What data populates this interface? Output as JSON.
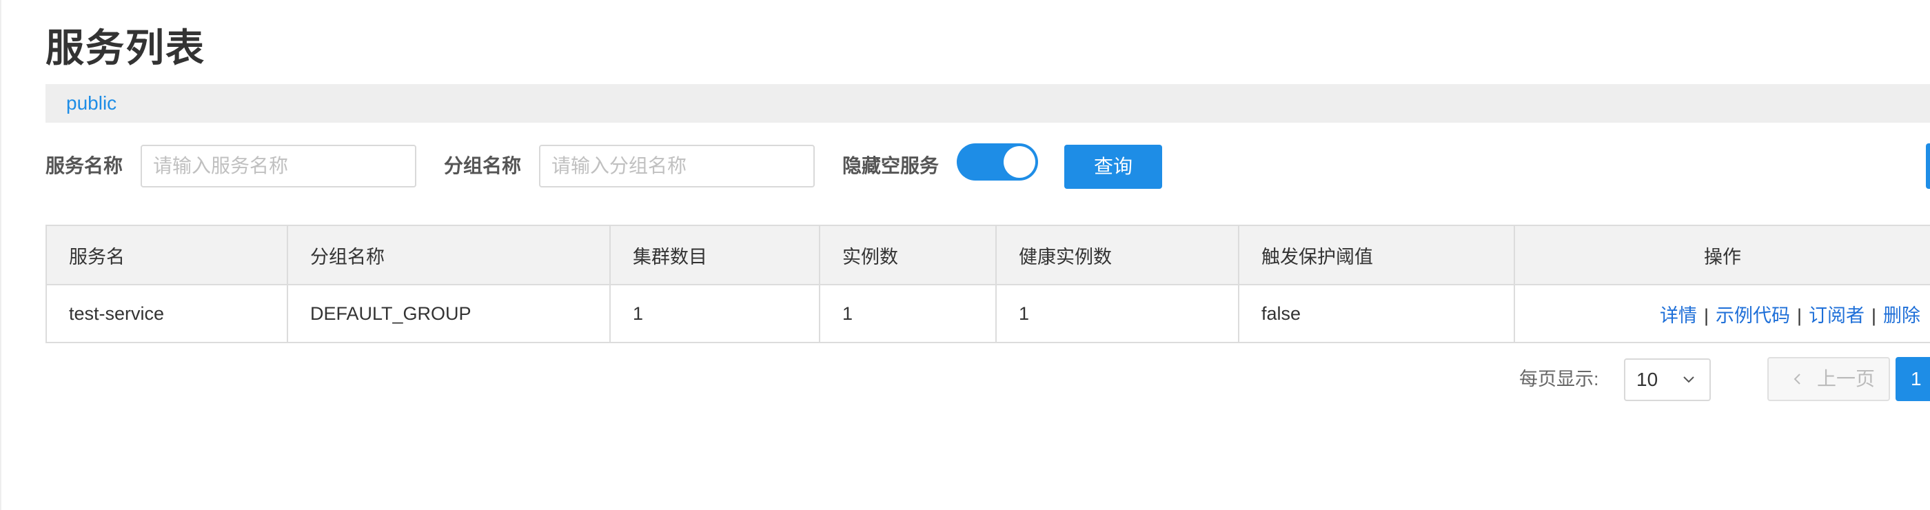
{
  "page": {
    "title": "服务列表"
  },
  "namespace_bar": {
    "items": [
      {
        "label": "public"
      }
    ]
  },
  "filters": {
    "service_name": {
      "label": "服务名称",
      "placeholder": "请输入服务名称",
      "value": ""
    },
    "group_name": {
      "label": "分组名称",
      "placeholder": "请输入分组名称",
      "value": ""
    },
    "hide_empty": {
      "label": "隐藏空服务",
      "on": true
    },
    "query_label": "查询"
  },
  "table": {
    "columns": [
      "服务名",
      "分组名称",
      "集群数目",
      "实例数",
      "健康实例数",
      "触发保护阈值",
      "操作"
    ],
    "rows": [
      {
        "service_name": "test-service",
        "group_name": "DEFAULT_GROUP",
        "cluster_count": "1",
        "instance_count": "1",
        "healthy_instance_count": "1",
        "protect_threshold": "false",
        "actions": [
          "详情",
          "示例代码",
          "订阅者",
          "删除"
        ],
        "separator": "|"
      }
    ]
  },
  "pagination": {
    "page_size_label": "每页显示:",
    "page_size": "10",
    "prev_label": "上一页",
    "current_page": "1"
  },
  "colors": {
    "accent": "#1e8de6",
    "link": "#1e6fd8",
    "header_bg": "#f2f2f2",
    "ns_bar_bg": "#eeeeee"
  },
  "icons": {
    "page_size_arrow": "chevron-down-icon",
    "prev_arrow": "chevron-left-icon"
  }
}
